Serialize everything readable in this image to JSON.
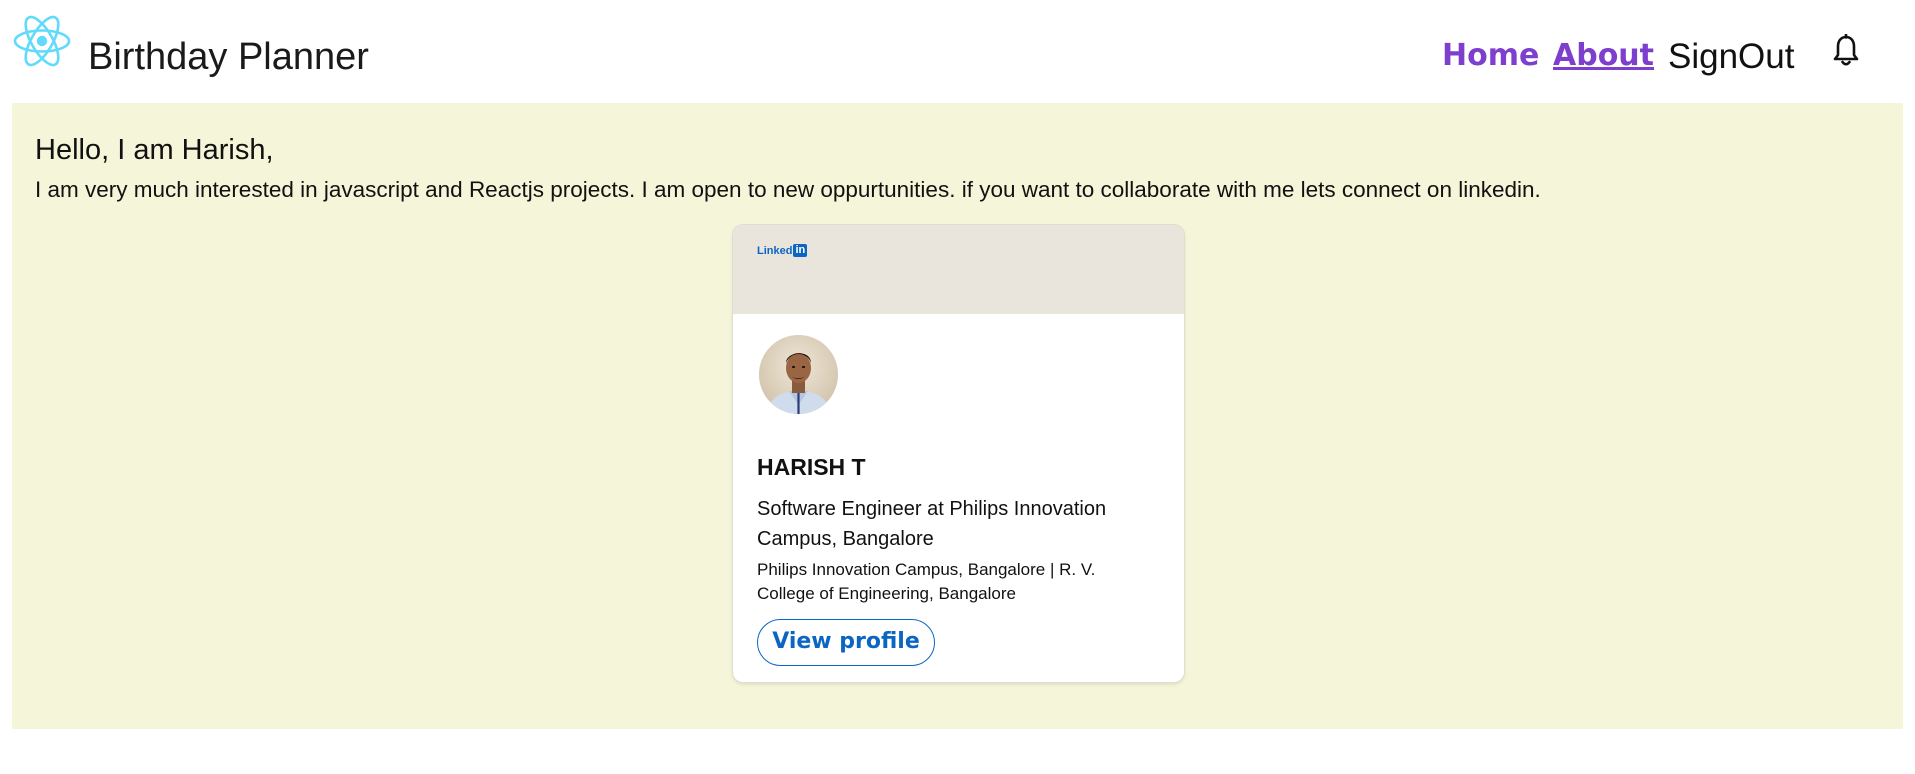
{
  "app": {
    "title": "Birthday Planner",
    "logo_icon": "react-atom-icon",
    "accent_color": "#7e3fce",
    "content_bg_color": "#f5f5d9"
  },
  "nav": {
    "home": "Home",
    "about": "About",
    "signout": "SignOut",
    "notification_icon": "bell-icon",
    "active": "About"
  },
  "about": {
    "greeting": "Hello, I am Harish,",
    "intro": "I am very much interested in javascript and Reactjs projects. I am open to new oppurtunities. if you want to collaborate with me lets connect on linkedin."
  },
  "linkedin_card": {
    "brand_word": "Linked",
    "brand_box": "in",
    "brand_color": "#0a66c2",
    "name": "HARISH T",
    "headline": "Software Engineer at Philips Innovation Campus, Bangalore",
    "detail": "Philips Innovation Campus, Bangalore | R. V. College of Engineering, Bangalore",
    "button": "View profile"
  }
}
